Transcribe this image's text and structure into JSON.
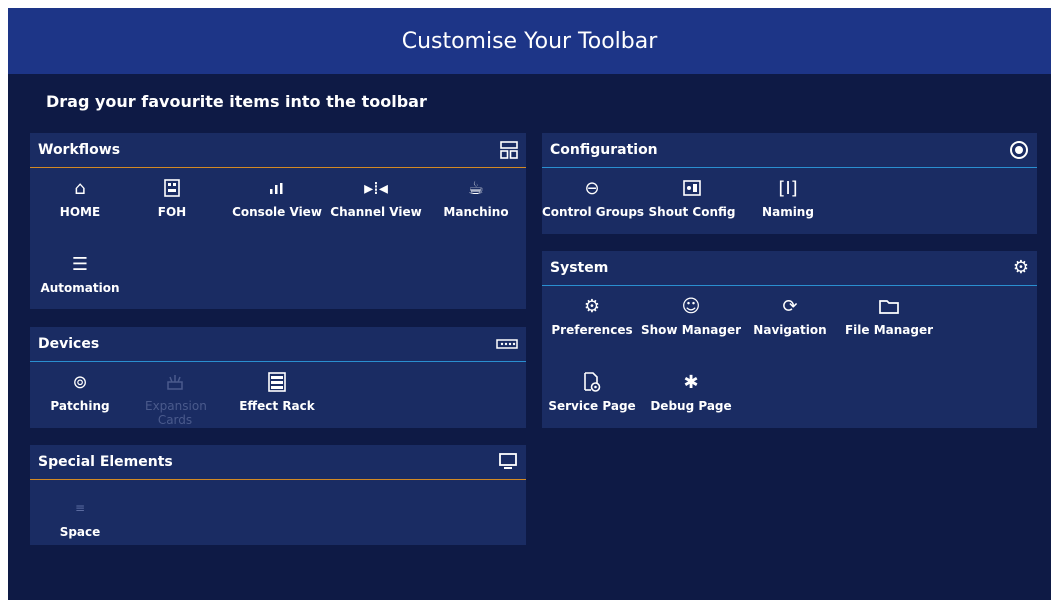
{
  "title": "Customise Your Toolbar",
  "instruction": "Drag your favourite items into the toolbar",
  "workflows": {
    "title": "Workflows",
    "items": [
      "HOME",
      "FOH",
      "Console View",
      "Channel View",
      "Manchino",
      "Automation"
    ]
  },
  "devices": {
    "title": "Devices",
    "items": [
      "Patching",
      "Expansion Cards",
      "Effect Rack"
    ]
  },
  "special": {
    "title": "Special Elements",
    "items": [
      "Space"
    ]
  },
  "configuration": {
    "title": "Configuration",
    "items": [
      "Control Groups",
      "Shout Config",
      "Naming"
    ]
  },
  "system": {
    "title": "System",
    "items": [
      "Preferences",
      "Show Manager",
      "Navigation",
      "File Manager",
      "Service Page",
      "Debug Page"
    ]
  },
  "colors": {
    "background": "#0e1a45",
    "header": "#1d3587",
    "panel": "#1a2c63",
    "accent_orange": "#d38a24",
    "accent_blue": "#2a8fd0"
  }
}
